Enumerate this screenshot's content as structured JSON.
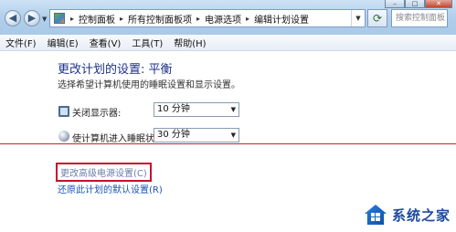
{
  "window": {
    "title_controls": {
      "minimize": "–",
      "maximize": "□",
      "close": "✕"
    }
  },
  "address": {
    "breadcrumbs": [
      "控制面板",
      "所有控制面板项",
      "电源选项",
      "编辑计划设置"
    ],
    "separator": "▸",
    "search_placeholder": "搜索控制面板"
  },
  "menu": {
    "items": [
      "文件(F)",
      "编辑(E)",
      "查看(V)",
      "工具(T)",
      "帮助(H)"
    ]
  },
  "page": {
    "title": "更改计划的设置: 平衡",
    "description": "选择希望计算机使用的睡眠设置和显示设置。",
    "settings": [
      {
        "label": "关闭显示器:",
        "value": "10 分钟",
        "icon": "monitor-icon"
      },
      {
        "label": "使计算机进入睡眠状态:",
        "value": "30 分钟",
        "icon": "sleep-moon-icon"
      }
    ],
    "links": {
      "advanced": "更改高级电源设置(C)",
      "restore": "还原此计划的默认设置(R)"
    }
  },
  "watermark": {
    "text": "系统之家"
  },
  "colors": {
    "title_blue": "#1e3287",
    "link_blue": "#1a52b8",
    "highlight_red": "#c8102e"
  }
}
